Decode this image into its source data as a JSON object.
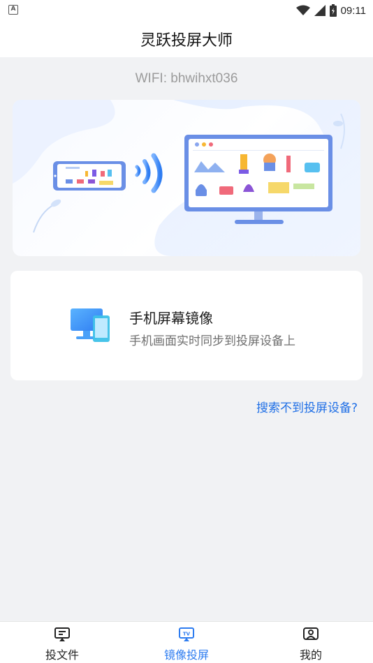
{
  "status_bar": {
    "time": "09:11",
    "left_icon": "A"
  },
  "header": {
    "title": "灵跃投屏大师"
  },
  "wifi_label": "WIFI: bhwihxt036",
  "mirror_card": {
    "title": "手机屏幕镜像",
    "subtitle": "手机画面实时同步到投屏设备上"
  },
  "help_link": "搜索不到投屏设备?",
  "bottom_nav": {
    "items": [
      {
        "label": "投文件",
        "icon": "cast-file-icon"
      },
      {
        "label": "镜像投屏",
        "icon": "tv-mirror-icon",
        "active": true
      },
      {
        "label": "我的",
        "icon": "profile-icon"
      }
    ]
  },
  "colors": {
    "accent": "#2d7cf0",
    "link": "#1f6fe6",
    "background": "#f1f2f4"
  }
}
